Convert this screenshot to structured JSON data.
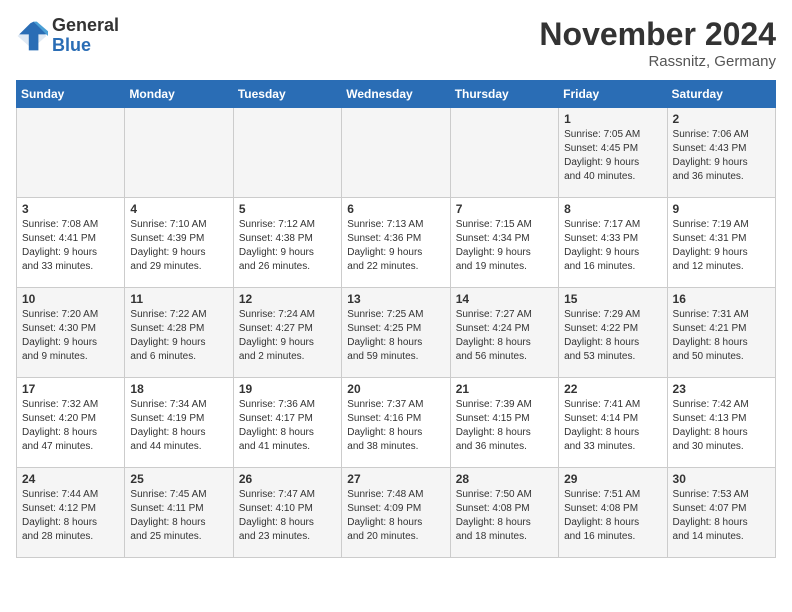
{
  "header": {
    "logo_general": "General",
    "logo_blue": "Blue",
    "month_title": "November 2024",
    "location": "Rassnitz, Germany"
  },
  "weekdays": [
    "Sunday",
    "Monday",
    "Tuesday",
    "Wednesday",
    "Thursday",
    "Friday",
    "Saturday"
  ],
  "weeks": [
    [
      {
        "day": "",
        "info": ""
      },
      {
        "day": "",
        "info": ""
      },
      {
        "day": "",
        "info": ""
      },
      {
        "day": "",
        "info": ""
      },
      {
        "day": "",
        "info": ""
      },
      {
        "day": "1",
        "info": "Sunrise: 7:05 AM\nSunset: 4:45 PM\nDaylight: 9 hours\nand 40 minutes."
      },
      {
        "day": "2",
        "info": "Sunrise: 7:06 AM\nSunset: 4:43 PM\nDaylight: 9 hours\nand 36 minutes."
      }
    ],
    [
      {
        "day": "3",
        "info": "Sunrise: 7:08 AM\nSunset: 4:41 PM\nDaylight: 9 hours\nand 33 minutes."
      },
      {
        "day": "4",
        "info": "Sunrise: 7:10 AM\nSunset: 4:39 PM\nDaylight: 9 hours\nand 29 minutes."
      },
      {
        "day": "5",
        "info": "Sunrise: 7:12 AM\nSunset: 4:38 PM\nDaylight: 9 hours\nand 26 minutes."
      },
      {
        "day": "6",
        "info": "Sunrise: 7:13 AM\nSunset: 4:36 PM\nDaylight: 9 hours\nand 22 minutes."
      },
      {
        "day": "7",
        "info": "Sunrise: 7:15 AM\nSunset: 4:34 PM\nDaylight: 9 hours\nand 19 minutes."
      },
      {
        "day": "8",
        "info": "Sunrise: 7:17 AM\nSunset: 4:33 PM\nDaylight: 9 hours\nand 16 minutes."
      },
      {
        "day": "9",
        "info": "Sunrise: 7:19 AM\nSunset: 4:31 PM\nDaylight: 9 hours\nand 12 minutes."
      }
    ],
    [
      {
        "day": "10",
        "info": "Sunrise: 7:20 AM\nSunset: 4:30 PM\nDaylight: 9 hours\nand 9 minutes."
      },
      {
        "day": "11",
        "info": "Sunrise: 7:22 AM\nSunset: 4:28 PM\nDaylight: 9 hours\nand 6 minutes."
      },
      {
        "day": "12",
        "info": "Sunrise: 7:24 AM\nSunset: 4:27 PM\nDaylight: 9 hours\nand 2 minutes."
      },
      {
        "day": "13",
        "info": "Sunrise: 7:25 AM\nSunset: 4:25 PM\nDaylight: 8 hours\nand 59 minutes."
      },
      {
        "day": "14",
        "info": "Sunrise: 7:27 AM\nSunset: 4:24 PM\nDaylight: 8 hours\nand 56 minutes."
      },
      {
        "day": "15",
        "info": "Sunrise: 7:29 AM\nSunset: 4:22 PM\nDaylight: 8 hours\nand 53 minutes."
      },
      {
        "day": "16",
        "info": "Sunrise: 7:31 AM\nSunset: 4:21 PM\nDaylight: 8 hours\nand 50 minutes."
      }
    ],
    [
      {
        "day": "17",
        "info": "Sunrise: 7:32 AM\nSunset: 4:20 PM\nDaylight: 8 hours\nand 47 minutes."
      },
      {
        "day": "18",
        "info": "Sunrise: 7:34 AM\nSunset: 4:19 PM\nDaylight: 8 hours\nand 44 minutes."
      },
      {
        "day": "19",
        "info": "Sunrise: 7:36 AM\nSunset: 4:17 PM\nDaylight: 8 hours\nand 41 minutes."
      },
      {
        "day": "20",
        "info": "Sunrise: 7:37 AM\nSunset: 4:16 PM\nDaylight: 8 hours\nand 38 minutes."
      },
      {
        "day": "21",
        "info": "Sunrise: 7:39 AM\nSunset: 4:15 PM\nDaylight: 8 hours\nand 36 minutes."
      },
      {
        "day": "22",
        "info": "Sunrise: 7:41 AM\nSunset: 4:14 PM\nDaylight: 8 hours\nand 33 minutes."
      },
      {
        "day": "23",
        "info": "Sunrise: 7:42 AM\nSunset: 4:13 PM\nDaylight: 8 hours\nand 30 minutes."
      }
    ],
    [
      {
        "day": "24",
        "info": "Sunrise: 7:44 AM\nSunset: 4:12 PM\nDaylight: 8 hours\nand 28 minutes."
      },
      {
        "day": "25",
        "info": "Sunrise: 7:45 AM\nSunset: 4:11 PM\nDaylight: 8 hours\nand 25 minutes."
      },
      {
        "day": "26",
        "info": "Sunrise: 7:47 AM\nSunset: 4:10 PM\nDaylight: 8 hours\nand 23 minutes."
      },
      {
        "day": "27",
        "info": "Sunrise: 7:48 AM\nSunset: 4:09 PM\nDaylight: 8 hours\nand 20 minutes."
      },
      {
        "day": "28",
        "info": "Sunrise: 7:50 AM\nSunset: 4:08 PM\nDaylight: 8 hours\nand 18 minutes."
      },
      {
        "day": "29",
        "info": "Sunrise: 7:51 AM\nSunset: 4:08 PM\nDaylight: 8 hours\nand 16 minutes."
      },
      {
        "day": "30",
        "info": "Sunrise: 7:53 AM\nSunset: 4:07 PM\nDaylight: 8 hours\nand 14 minutes."
      }
    ]
  ]
}
